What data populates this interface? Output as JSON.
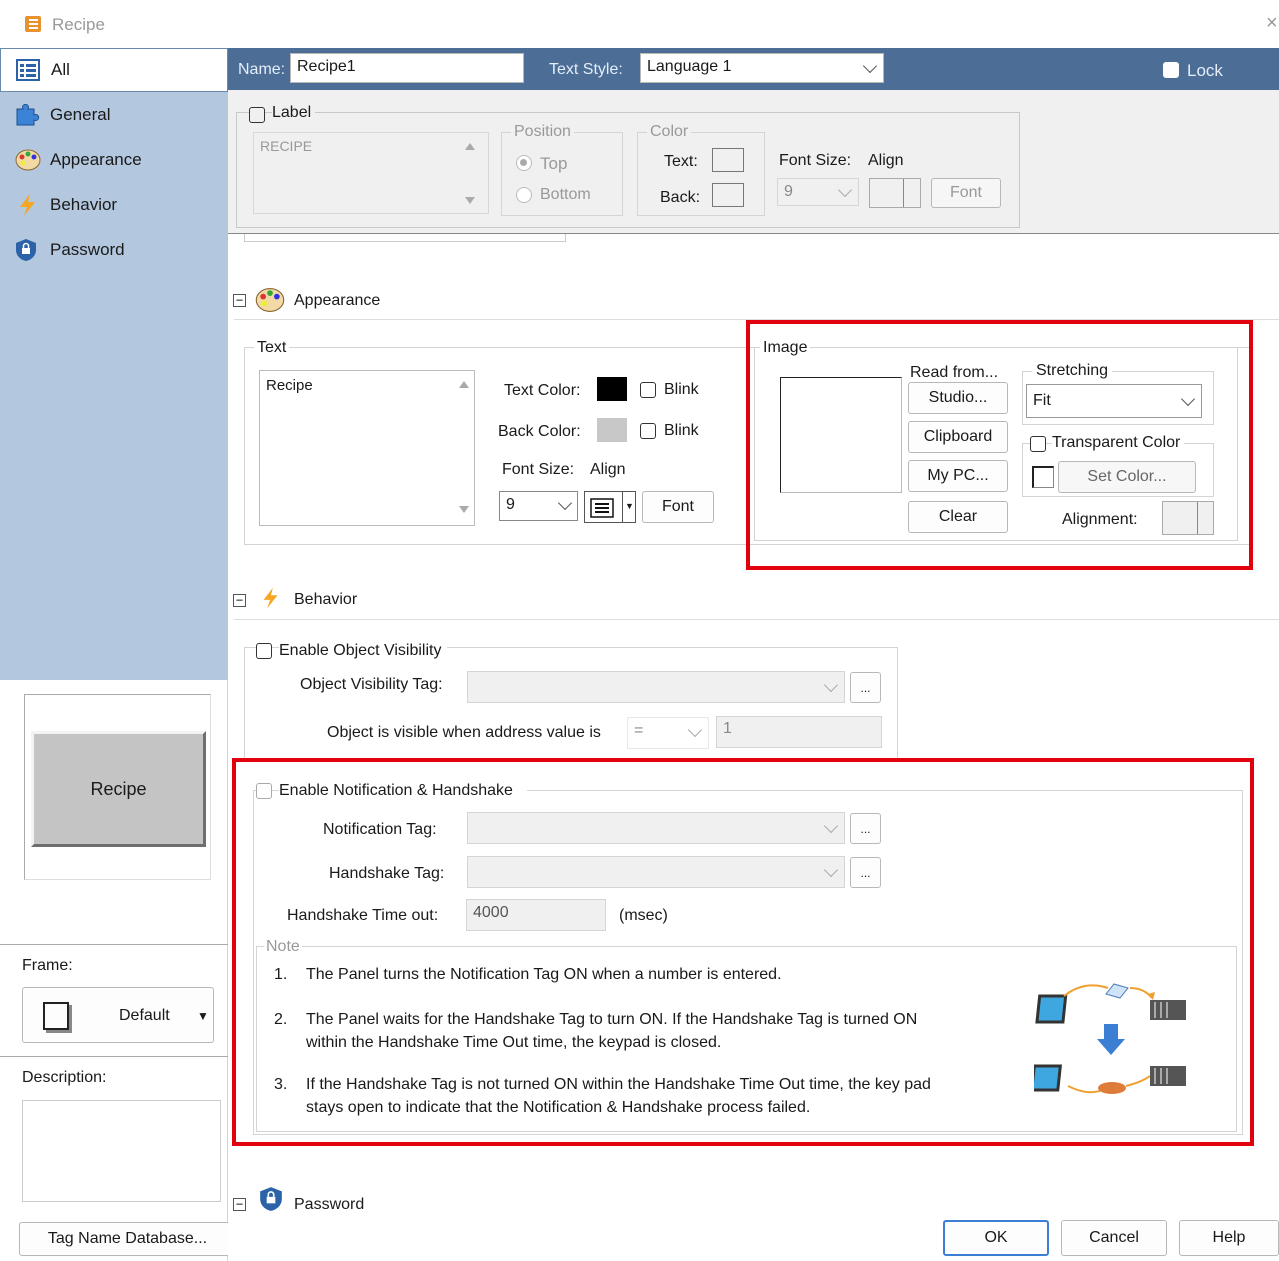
{
  "window": {
    "title": "Recipe",
    "close": "×"
  },
  "sidebar": {
    "items": [
      {
        "label": "All"
      },
      {
        "label": "General"
      },
      {
        "label": "Appearance"
      },
      {
        "label": "Behavior"
      },
      {
        "label": "Password"
      }
    ],
    "preview_label": "Recipe",
    "frame_label": "Frame:",
    "frame_value": "Default",
    "description_label": "Description:"
  },
  "header": {
    "name_label": "Name:",
    "name_value": "Recipe1",
    "text_style_label": "Text Style:",
    "text_style_value": "Language 1",
    "lock_label": "Lock"
  },
  "label_section": {
    "label": "Label",
    "text": "RECIPE",
    "position_title": "Position",
    "top": "Top",
    "bottom": "Bottom",
    "color_title": "Color",
    "text_color": "Text:",
    "back_color": "Back:",
    "font_size_label": "Font Size:",
    "align_label": "Align",
    "font_size_value": "9",
    "font_button": "Font"
  },
  "appearance": {
    "heading": "Appearance",
    "text_group": "Text",
    "text_value": "Recipe",
    "text_color_label": "Text Color:",
    "text_color": "#000000",
    "back_color_label": "Back Color:",
    "back_color": "#c8c8c8",
    "blink": "Blink",
    "font_size_label": "Font Size:",
    "align_label": "Align",
    "font_size_value": "9",
    "font_button": "Font",
    "image_group": "Image",
    "read_from": "Read from...",
    "studio": "Studio...",
    "clipboard": "Clipboard",
    "mypc": "My PC...",
    "clear": "Clear",
    "stretching_title": "Stretching",
    "stretching_value": "Fit",
    "transparent_color": "Transparent Color",
    "set_color": "Set Color...",
    "alignment_label": "Alignment:"
  },
  "behavior": {
    "heading": "Behavior",
    "enable_visibility": "Enable Object Visibility",
    "visibility_tag_label": "Object Visibility Tag:",
    "visible_when_label": "Object is visible when address value is",
    "operator": "=",
    "compare_value": "1",
    "browse": "...",
    "enable_notification": "Enable Notification & Handshake",
    "notification_tag_label": "Notification Tag:",
    "handshake_tag_label": "Handshake Tag:",
    "timeout_label": "Handshake Time out:",
    "timeout_value": "4000",
    "timeout_unit": "(msec)",
    "note_title": "Note",
    "notes": [
      {
        "num": "1.",
        "line1": "The Panel turns the Notification Tag ON when a number is entered.",
        "line2": ""
      },
      {
        "num": "2.",
        "line1": "The Panel waits for the Handshake Tag to turn ON.  If the Handshake Tag is turned ON",
        "line2": "within the Handshake Time Out time, the keypad is closed."
      },
      {
        "num": "3.",
        "line1": "If the Handshake Tag is not turned ON within the Handshake Time Out time, the key pad",
        "line2": "stays open to indicate that the Notification & Handshake process failed."
      }
    ]
  },
  "password": {
    "heading": "Password"
  },
  "footer": {
    "tag_db": "Tag Name Database...",
    "ok": "OK",
    "cancel": "Cancel",
    "help": "Help"
  },
  "colors": {
    "sidebar": "#b3c7de",
    "header": "#4b6d96",
    "highlight": "#e0000e",
    "accent": "#3a7fd4"
  },
  "icons": [
    "recipe-icon",
    "all-list-icon",
    "general-puzzle-icon",
    "appearance-palette-icon",
    "behavior-lightning-icon",
    "password-shield-icon",
    "panel-monitor-icon",
    "plc-device-icon",
    "handshake-icon",
    "down-arrow-icon"
  ]
}
